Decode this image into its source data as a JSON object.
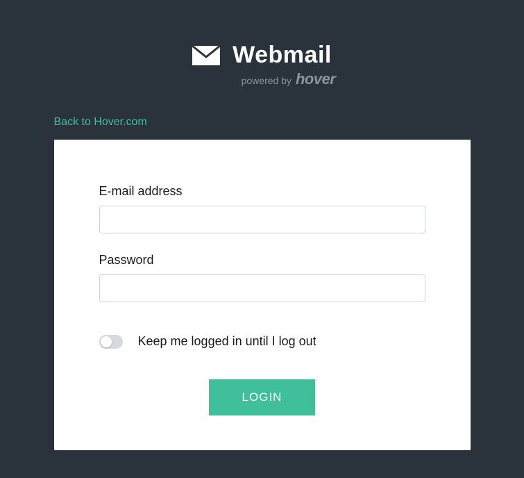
{
  "logo": {
    "title": "Webmail",
    "powered_by_label": "powered by",
    "brand": "hover"
  },
  "back_link": {
    "label": "Back to Hover.com"
  },
  "form": {
    "email_label": "E-mail address",
    "email_value": "",
    "password_label": "Password",
    "password_value": "",
    "keep_logged_label": "Keep me logged in until I log out",
    "login_button": "LOGIN"
  }
}
